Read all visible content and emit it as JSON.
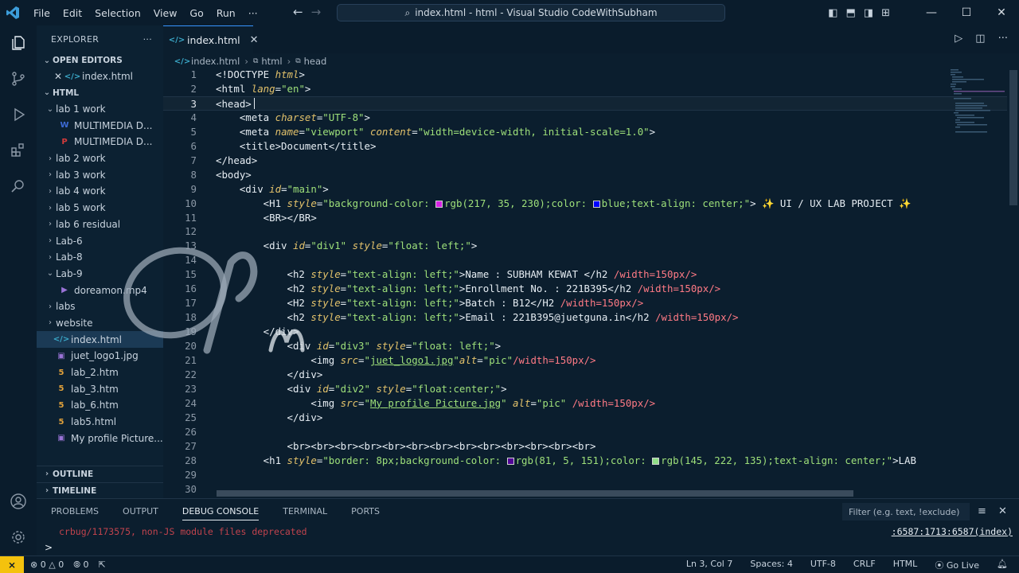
{
  "window": {
    "title": "index.html - html - Visual Studio CodeWithSubham",
    "menu": [
      "File",
      "Edit",
      "Selection",
      "View",
      "Go",
      "Run",
      "···"
    ]
  },
  "explorer": {
    "header": "EXPLORER",
    "open_editors_label": "OPEN EDITORS",
    "open_file": "index.html",
    "root_label": "HTML",
    "tree": [
      {
        "label": "lab 1 work",
        "kind": "folder",
        "open": true,
        "depth": 0
      },
      {
        "label": "MULTIMEDIA D...",
        "kind": "word",
        "depth": 1
      },
      {
        "label": "MULTIMEDIA D...",
        "kind": "pdf",
        "depth": 1
      },
      {
        "label": "lab 2 work",
        "kind": "folder",
        "open": false,
        "depth": 0
      },
      {
        "label": "lab 3 work",
        "kind": "folder",
        "open": false,
        "depth": 0
      },
      {
        "label": "lab 4 work",
        "kind": "folder",
        "open": false,
        "depth": 0
      },
      {
        "label": "lab 5 work",
        "kind": "folder",
        "open": false,
        "depth": 0
      },
      {
        "label": "lab 6 residual",
        "kind": "folder",
        "open": false,
        "depth": 0
      },
      {
        "label": "Lab-6",
        "kind": "folder",
        "open": false,
        "depth": 0
      },
      {
        "label": "Lab-8",
        "kind": "folder",
        "open": false,
        "depth": 0
      },
      {
        "label": "Lab-9",
        "kind": "folder",
        "open": true,
        "depth": 0
      },
      {
        "label": "doreamon.mp4",
        "kind": "video",
        "depth": 1
      },
      {
        "label": "labs",
        "kind": "folder",
        "open": false,
        "depth": 0
      },
      {
        "label": "website",
        "kind": "folder",
        "open": false,
        "depth": 0
      },
      {
        "label": "index.html",
        "kind": "html",
        "depth": 0,
        "active": true
      },
      {
        "label": "juet_logo1.jpg",
        "kind": "image",
        "depth": 0
      },
      {
        "label": "lab_2.htm",
        "kind": "html5",
        "depth": 0
      },
      {
        "label": "lab_3.htm",
        "kind": "html5",
        "depth": 0
      },
      {
        "label": "lab_6.htm",
        "kind": "html5",
        "depth": 0
      },
      {
        "label": "lab5.html",
        "kind": "html5",
        "depth": 0
      },
      {
        "label": "My profile Picture...",
        "kind": "image",
        "depth": 0
      }
    ],
    "outline_label": "OUTLINE",
    "timeline_label": "TIMELINE"
  },
  "editor": {
    "tab_label": "index.html",
    "breadcrumb": [
      "index.html",
      "html",
      "head"
    ],
    "current_line": 3,
    "lines": [
      [
        [
          "t",
          "<!DOCTYPE "
        ],
        [
          "a",
          "html"
        ],
        [
          "t",
          ">"
        ]
      ],
      [
        [
          "t",
          "<html "
        ],
        [
          "a",
          "lang"
        ],
        [
          "t",
          "="
        ],
        [
          "s",
          "\"en\""
        ],
        [
          "t",
          ">"
        ]
      ],
      [
        [
          "t",
          "<head>"
        ]
      ],
      [
        [
          "t",
          "    <meta "
        ],
        [
          "a",
          "charset"
        ],
        [
          "t",
          "="
        ],
        [
          "s",
          "\"UTF-8\""
        ],
        [
          "t",
          ">"
        ]
      ],
      [
        [
          "t",
          "    <meta "
        ],
        [
          "a",
          "name"
        ],
        [
          "t",
          "="
        ],
        [
          "s",
          "\"viewport\""
        ],
        [
          "t",
          " "
        ],
        [
          "a",
          "content"
        ],
        [
          "t",
          "="
        ],
        [
          "s",
          "\"width=device-width, initial-scale=1.0\""
        ],
        [
          "t",
          ">"
        ]
      ],
      [
        [
          "t",
          "    <title>Document</title>"
        ]
      ],
      [
        [
          "t",
          "</head>"
        ]
      ],
      [
        [
          "t",
          "<body>"
        ]
      ],
      [
        [
          "t",
          "    <div "
        ],
        [
          "a",
          "id"
        ],
        [
          "t",
          "="
        ],
        [
          "s",
          "\"main\""
        ],
        [
          "t",
          ">"
        ]
      ],
      [
        [
          "t",
          "        <H1 "
        ],
        [
          "a",
          "style"
        ],
        [
          "t",
          "="
        ],
        [
          "s",
          "\"background-color: "
        ],
        [
          "sw",
          "#d923e6"
        ],
        [
          "s",
          "rgb(217, 35, 230);color: "
        ],
        [
          "sw",
          "#0000ff"
        ],
        [
          "s",
          "blue;text-align: center;\""
        ],
        [
          "t",
          "> ✨ UI / UX LAB PROJECT ✨"
        ]
      ],
      [
        [
          "t",
          "        <BR></BR>"
        ]
      ],
      [],
      [
        [
          "t",
          "        <div "
        ],
        [
          "a",
          "id"
        ],
        [
          "t",
          "="
        ],
        [
          "s",
          "\"div1\""
        ],
        [
          "t",
          " "
        ],
        [
          "a",
          "style"
        ],
        [
          "t",
          "="
        ],
        [
          "s",
          "\"float: left;\""
        ],
        [
          "t",
          ">"
        ]
      ],
      [],
      [
        [
          "t",
          "            <h2 "
        ],
        [
          "a",
          "style"
        ],
        [
          "t",
          "="
        ],
        [
          "s",
          "\"text-align: left;\""
        ],
        [
          "t",
          ">Name : SUBHAM KEWAT </h2 "
        ],
        [
          "c",
          "/width=150px/>"
        ]
      ],
      [
        [
          "t",
          "            <h2 "
        ],
        [
          "a",
          "style"
        ],
        [
          "t",
          "="
        ],
        [
          "s",
          "\"text-align: left;\""
        ],
        [
          "t",
          ">Enrollment No. : 221B395</h2 "
        ],
        [
          "c",
          "/width=150px/>"
        ]
      ],
      [
        [
          "t",
          "            <H2 "
        ],
        [
          "a",
          "style"
        ],
        [
          "t",
          "="
        ],
        [
          "s",
          "\"text-align: left;\""
        ],
        [
          "t",
          ">Batch : B12</H2 "
        ],
        [
          "c",
          "/width=150px/>"
        ]
      ],
      [
        [
          "t",
          "            <h2 "
        ],
        [
          "a",
          "style"
        ],
        [
          "t",
          "="
        ],
        [
          "s",
          "\"text-align: left;\""
        ],
        [
          "t",
          ">Email : 221B395@juetguna.in</h2 "
        ],
        [
          "c",
          "/width=150px/>"
        ]
      ],
      [
        [
          "t",
          "        </div>"
        ]
      ],
      [
        [
          "t",
          "            <div "
        ],
        [
          "a",
          "id"
        ],
        [
          "t",
          "="
        ],
        [
          "s",
          "\"div3\""
        ],
        [
          "t",
          " "
        ],
        [
          "a",
          "style"
        ],
        [
          "t",
          "="
        ],
        [
          "s",
          "\"float: left;\""
        ],
        [
          "t",
          ">"
        ]
      ],
      [
        [
          "t",
          "                <img "
        ],
        [
          "a",
          "src"
        ],
        [
          "t",
          "="
        ],
        [
          "s",
          "\""
        ],
        [
          "u",
          "juet_logo1.jpg"
        ],
        [
          "s",
          "\""
        ],
        [
          "a",
          "alt"
        ],
        [
          "t",
          "="
        ],
        [
          "s",
          "\"pic\""
        ],
        [
          "c",
          "/width=150px/>"
        ]
      ],
      [
        [
          "t",
          "            </div>"
        ]
      ],
      [
        [
          "t",
          "            <div "
        ],
        [
          "a",
          "id"
        ],
        [
          "t",
          "="
        ],
        [
          "s",
          "\"div2\""
        ],
        [
          "t",
          " "
        ],
        [
          "a",
          "style"
        ],
        [
          "t",
          "="
        ],
        [
          "s",
          "\"float:center;\""
        ],
        [
          "t",
          ">"
        ]
      ],
      [
        [
          "t",
          "                <img "
        ],
        [
          "a",
          "src"
        ],
        [
          "t",
          "="
        ],
        [
          "s",
          "\""
        ],
        [
          "u",
          "My profile Picture.jpg"
        ],
        [
          "s",
          "\""
        ],
        [
          "t",
          " "
        ],
        [
          "a",
          "alt"
        ],
        [
          "t",
          "="
        ],
        [
          "s",
          "\"pic\""
        ],
        [
          "t",
          " "
        ],
        [
          "c",
          "/width=150px/>"
        ]
      ],
      [
        [
          "t",
          "            </div>"
        ]
      ],
      [],
      [
        [
          "t",
          "            <br><br><br><br><br><br><br><br><br><br><br><br><br>"
        ]
      ],
      [
        [
          "t",
          "        <h1 "
        ],
        [
          "a",
          "style"
        ],
        [
          "t",
          "="
        ],
        [
          "s",
          "\"border: 8px;background-color: "
        ],
        [
          "sw",
          "#510597"
        ],
        [
          "s",
          "rgb(81, 5, 151);color: "
        ],
        [
          "sw",
          "#91de87"
        ],
        [
          "s",
          "rgb(145, 222, 135);text-align: center;\""
        ],
        [
          "t",
          ">LAB"
        ]
      ],
      [],
      []
    ]
  },
  "panel": {
    "tabs": [
      "PROBLEMS",
      "OUTPUT",
      "DEBUG CONSOLE",
      "TERMINAL",
      "PORTS"
    ],
    "active_tab": "DEBUG CONSOLE",
    "filter_placeholder": "Filter (e.g. text, !exclude)",
    "message": "crbug/1173575, non-JS module files deprecated",
    "source": ":6587:1713:6587(index)",
    "prompt": ">"
  },
  "statusbar": {
    "errors": "0",
    "warnings": "0",
    "ports": "0",
    "position": "Ln 3, Col 7",
    "spaces": "Spaces: 4",
    "encoding": "UTF-8",
    "eol": "CRLF",
    "language": "HTML",
    "golive": "Go Live"
  }
}
